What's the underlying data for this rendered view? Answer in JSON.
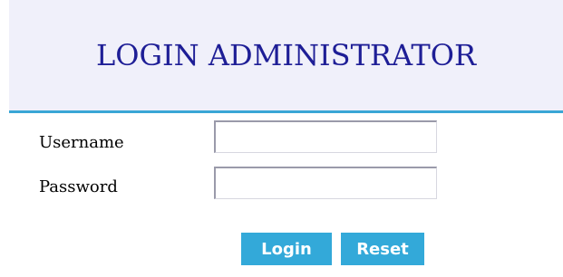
{
  "header": {
    "title": "LOGIN ADMINISTRATOR"
  },
  "form": {
    "username_label": "Username",
    "username_value": "",
    "password_label": "Password",
    "password_value": "",
    "login_label": "Login",
    "reset_label": "Reset"
  },
  "colors": {
    "title": "#1e1e96",
    "accent": "#33a9d9",
    "header_bg": "#f0f0fa"
  }
}
